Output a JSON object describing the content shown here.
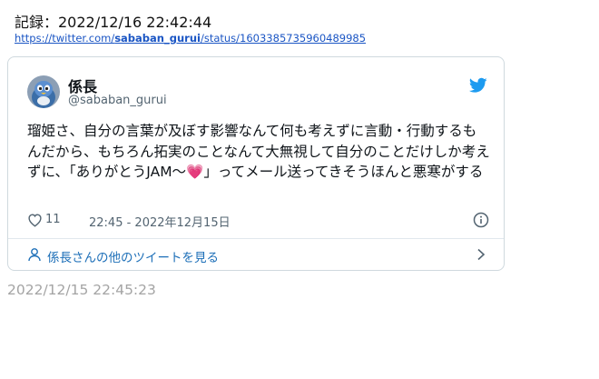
{
  "record": {
    "title": "記録：2022/12/16 22:42:44",
    "link_prefix": "https://twitter.com/",
    "link_user": "sababan_gurui",
    "link_suffix": "/status/1603385735960489985"
  },
  "tweet": {
    "author_name": "係長",
    "author_handle": "@sababan_gurui",
    "text_before_emoji": "瑠姫さ、自分の言葉が及ぼす影響なんて何も考えずに言動・行動するもんだから、もちろん拓実のことなんて大無視して自分のことだけしか考えずに、「ありがとうJAM〜",
    "emoji": "💗",
    "text_after_emoji": "」ってメール送ってきそうほんと悪寒がする",
    "like_count": "11",
    "timestamp": "22:45 - 2022年12月15日",
    "more_tweets_label": "係長さんの他のツイートを見る"
  },
  "footer": {
    "date": "2022/12/15 22:45:23"
  },
  "colors": {
    "link": "#1a55c4",
    "twitter_blue": "#1d9bf0",
    "muted": "#536471",
    "footer_gray": "#a4a4a4"
  },
  "icons": [
    "twitter-bird-icon",
    "heart-outline-icon",
    "info-icon",
    "person-icon",
    "chevron-right-icon"
  ]
}
